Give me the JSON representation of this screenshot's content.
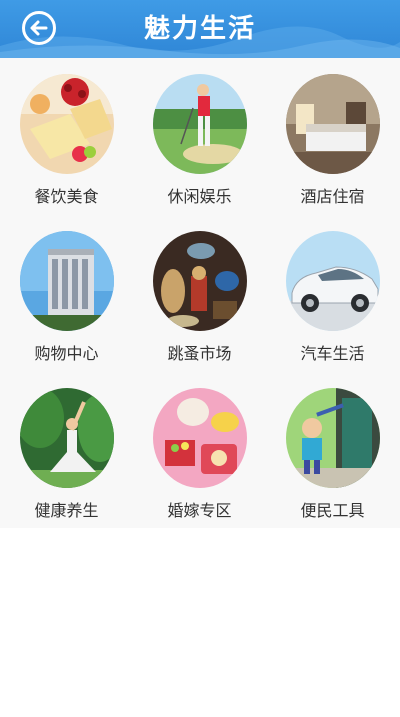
{
  "header": {
    "title": "魅力生活",
    "back_icon": "back-arrow-icon",
    "bg_color": "#3a94e0"
  },
  "categories": [
    {
      "label": "餐饮美食",
      "icon": "food-photo"
    },
    {
      "label": "休闲娱乐",
      "icon": "golf-photo"
    },
    {
      "label": "酒店住宿",
      "icon": "hotel-room-photo"
    },
    {
      "label": "购物中心",
      "icon": "building-photo"
    },
    {
      "label": "跳蚤市场",
      "icon": "antiques-photo"
    },
    {
      "label": "汽车生活",
      "icon": "car-photo"
    },
    {
      "label": "健康养生",
      "icon": "yoga-photo"
    },
    {
      "label": "婚嫁专区",
      "icon": "wedding-photo"
    },
    {
      "label": "便民工具",
      "icon": "kids-photo"
    }
  ]
}
